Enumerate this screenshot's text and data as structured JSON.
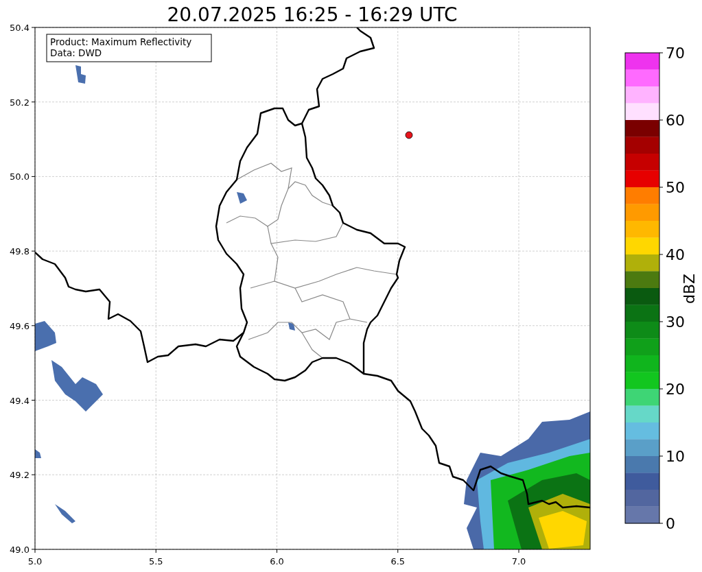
{
  "title": "20.07.2025 16:25 - 16:29 UTC",
  "legend": {
    "lines": [
      "Product: Maximum Reflectivity",
      "Data: DWD"
    ]
  },
  "map": {
    "x_ticks": [
      "5.0",
      "5.5",
      "6.0",
      "6.5",
      "7.0"
    ],
    "y_ticks": [
      "50.4",
      "50.2",
      "50.0",
      "49.8",
      "49.6",
      "49.4",
      "49.2",
      "49.0"
    ]
  },
  "colorbar": {
    "label": "dBZ",
    "ticks": [
      "70",
      "60",
      "50",
      "40",
      "30",
      "20",
      "10",
      "0"
    ],
    "bins": [
      {
        "color": "#ee33ee"
      },
      {
        "color": "#ff6aff"
      },
      {
        "color": "#ffb3ff"
      },
      {
        "color": "#ffe0ff"
      },
      {
        "color": "#7a0000"
      },
      {
        "color": "#a40000"
      },
      {
        "color": "#c60000"
      },
      {
        "color": "#e60000"
      },
      {
        "color": "#ff7d00"
      },
      {
        "color": "#ff9a00"
      },
      {
        "color": "#ffb800"
      },
      {
        "color": "#ffd700"
      },
      {
        "color": "#b0b00a"
      },
      {
        "color": "#4c7a10"
      },
      {
        "color": "#0a5a10"
      },
      {
        "color": "#0b7314"
      },
      {
        "color": "#0e8b18"
      },
      {
        "color": "#10a01a"
      },
      {
        "color": "#10b51d"
      },
      {
        "color": "#12c61f"
      },
      {
        "color": "#3ed575"
      },
      {
        "color": "#66d8c8"
      },
      {
        "color": "#65bde0"
      },
      {
        "color": "#5a9fc8"
      },
      {
        "color": "#4a79ad"
      },
      {
        "color": "#3f5b9d"
      },
      {
        "color": "#52669f"
      },
      {
        "color": "#6677aa"
      }
    ]
  }
}
